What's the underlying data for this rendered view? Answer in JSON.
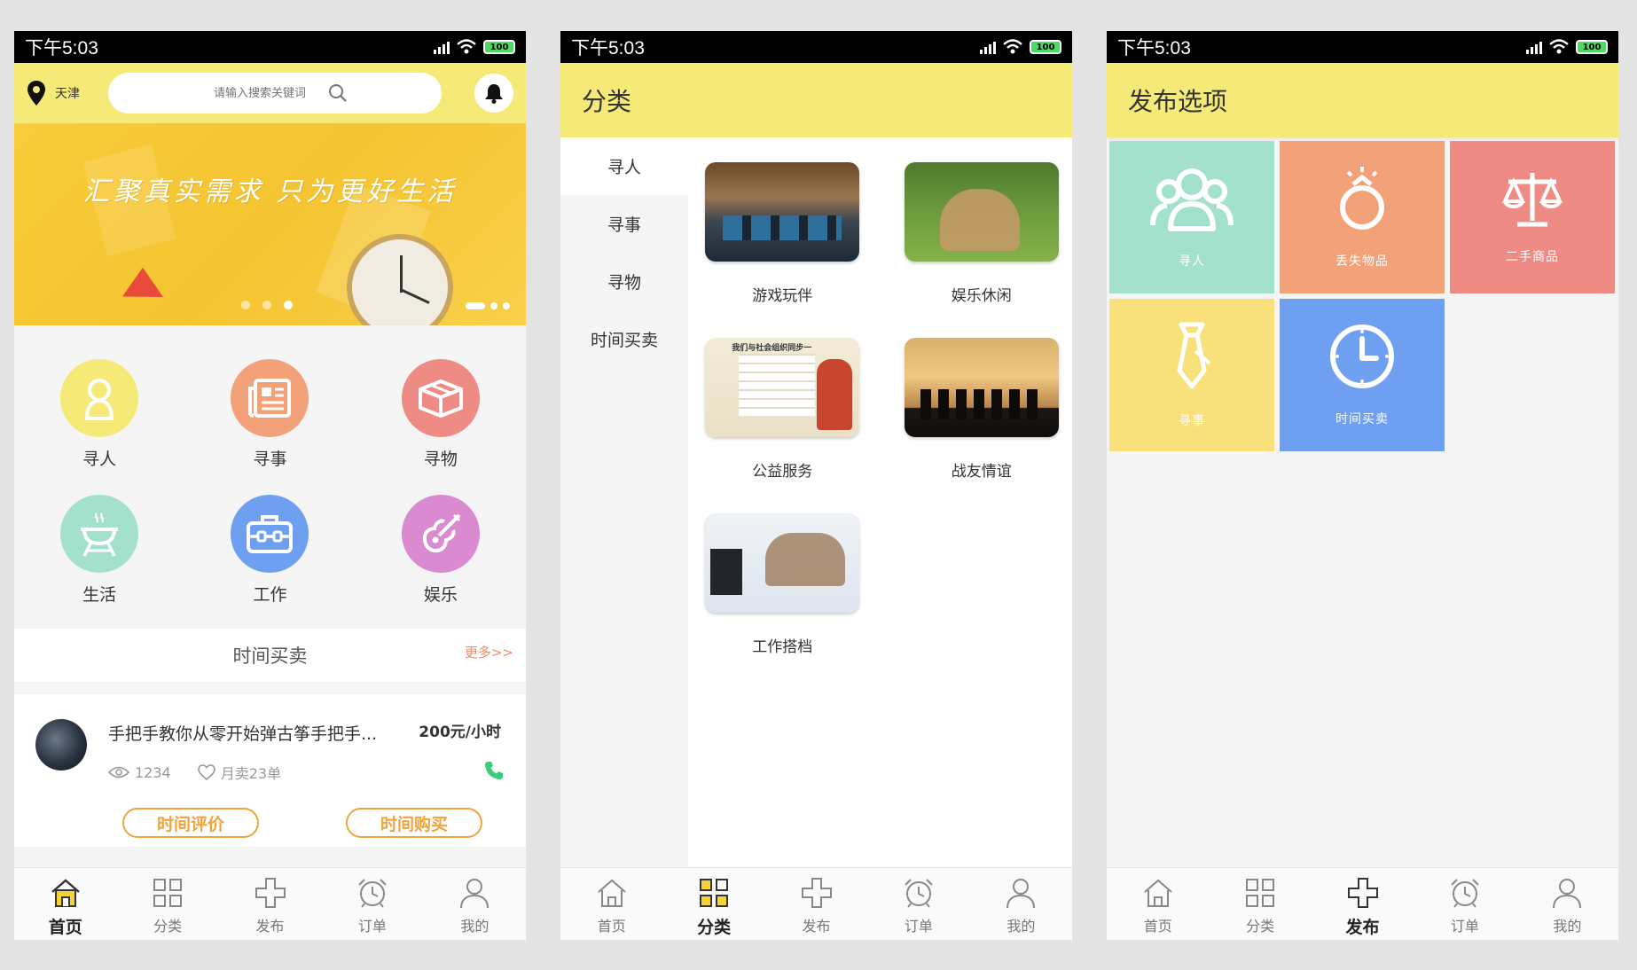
{
  "status_time": "下午5:03",
  "battery": "100",
  "home": {
    "city": "天津",
    "search_placeholder": "请输入搜索关键词",
    "banner_slogan": "汇聚真实需求 只为更好生活",
    "categories": [
      {
        "label": "寻人",
        "color": "#f5e978"
      },
      {
        "label": "寻事",
        "color": "#f3a178"
      },
      {
        "label": "寻物",
        "color": "#ef8b85"
      },
      {
        "label": "生活",
        "color": "#a3e1cc"
      },
      {
        "label": "工作",
        "color": "#6f9ff1"
      },
      {
        "label": "娱乐",
        "color": "#d98ad1"
      }
    ],
    "section_title": "时间买卖",
    "section_more": "更多>>",
    "item": {
      "title": "手把手教你从零开始弹古筝手把手...",
      "price": "200元/小时",
      "views": "1234",
      "sales": "月卖23单",
      "btn_review": "时间评价",
      "btn_buy": "时间购买"
    }
  },
  "tabs": [
    {
      "label": "首页",
      "icon": "home-icon"
    },
    {
      "label": "分类",
      "icon": "grid-icon"
    },
    {
      "label": "发布",
      "icon": "plus-icon"
    },
    {
      "label": "订单",
      "icon": "alarm-clock-icon"
    },
    {
      "label": "我的",
      "icon": "user-icon"
    }
  ],
  "category_page": {
    "title": "分类",
    "side": [
      "寻人",
      "寻事",
      "寻物",
      "时间买卖"
    ],
    "items": [
      "游戏玩伴",
      "娱乐休闲",
      "公益服务",
      "战友情谊",
      "工作搭档"
    ],
    "poster_text": "我们与社会组织同步一"
  },
  "publish_page": {
    "title": "发布选项",
    "options": [
      {
        "label": "寻人",
        "color": "#a3e1cc",
        "icon": "people-group-icon"
      },
      {
        "label": "丢失物品",
        "color": "#f3a178",
        "icon": "ring-icon"
      },
      {
        "label": "二手商品",
        "color": "#ef8b85",
        "icon": "scale-icon"
      },
      {
        "label": "寻事",
        "color": "#f8e17a",
        "icon": "tie-icon"
      },
      {
        "label": "时间买卖",
        "color": "#6f9ff1",
        "icon": "clock-icon"
      }
    ]
  }
}
